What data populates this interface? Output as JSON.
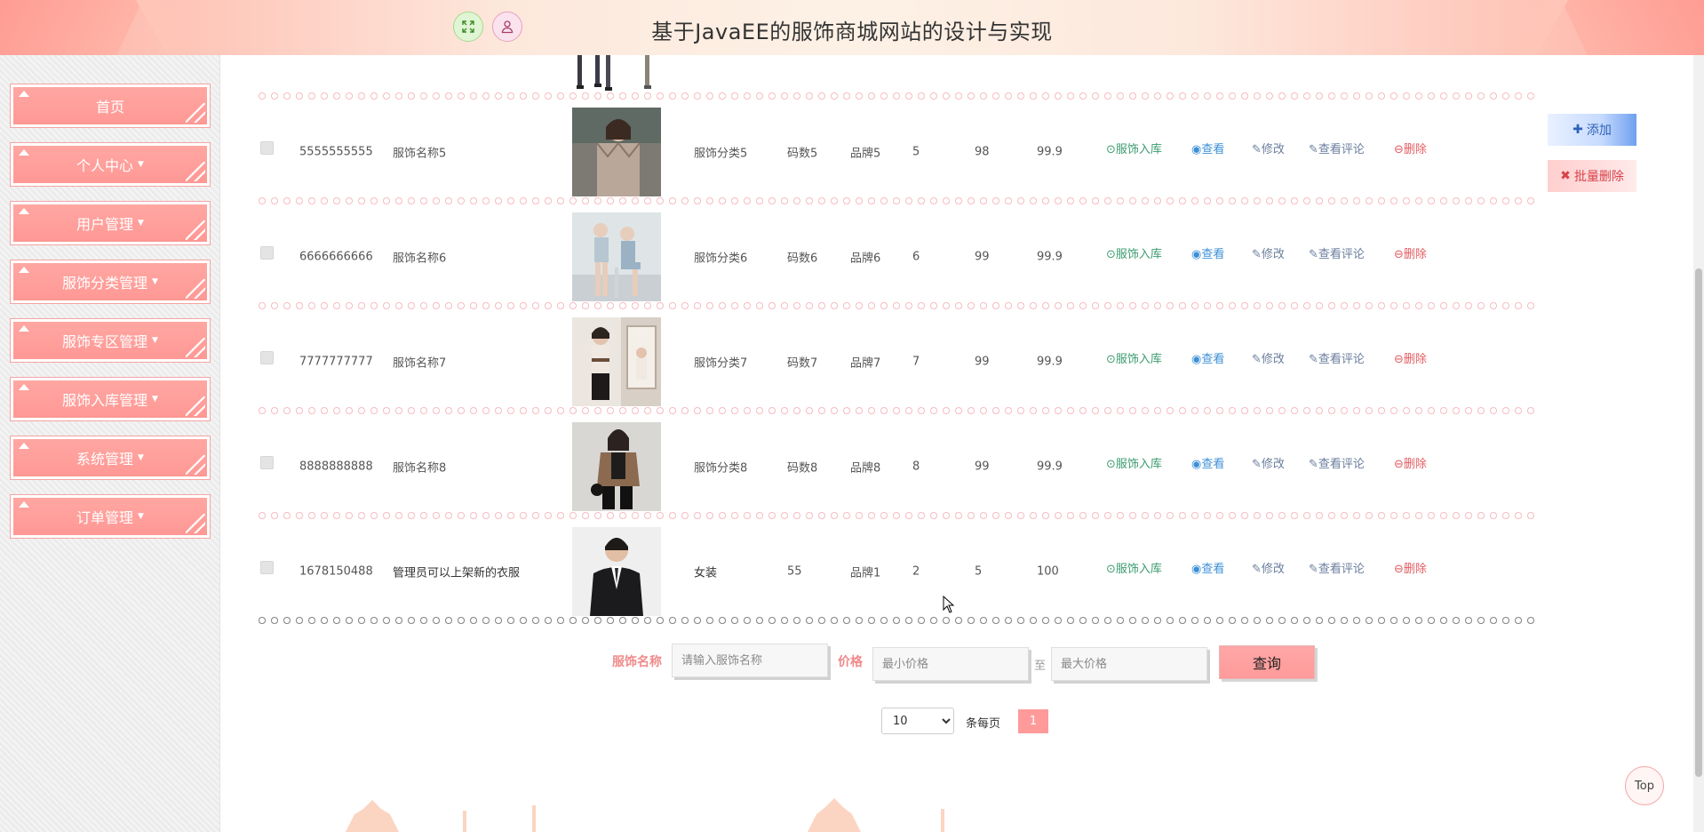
{
  "header": {
    "title": "基于JavaEE的服饰商城网站的设计与实现"
  },
  "sidebar": {
    "items": [
      {
        "label": "首页",
        "has_caret": false
      },
      {
        "label": "个人中心",
        "has_caret": true
      },
      {
        "label": "用户管理",
        "has_caret": true
      },
      {
        "label": "服饰分类管理",
        "has_caret": true
      },
      {
        "label": "服饰专区管理",
        "has_caret": true
      },
      {
        "label": "服饰入库管理",
        "has_caret": true
      },
      {
        "label": "系统管理",
        "has_caret": true
      },
      {
        "label": "订单管理",
        "has_caret": true
      }
    ]
  },
  "toolbar": {
    "add_label": "添加",
    "batch_delete_label": "批量删除"
  },
  "actions": {
    "stock_in": "服饰入库",
    "view": "查看",
    "edit": "修改",
    "view_comments": "查看评论",
    "delete": "删除"
  },
  "table": {
    "rows": [
      {
        "id": "5555555555",
        "name": "服饰名称5",
        "category": "服饰分类5",
        "size": "码数5",
        "brand": "品牌5",
        "col_a": "5",
        "col_b": "98",
        "price": "99.9"
      },
      {
        "id": "6666666666",
        "name": "服饰名称6",
        "category": "服饰分类6",
        "size": "码数6",
        "brand": "品牌6",
        "col_a": "6",
        "col_b": "99",
        "price": "99.9"
      },
      {
        "id": "7777777777",
        "name": "服饰名称7",
        "category": "服饰分类7",
        "size": "码数7",
        "brand": "品牌7",
        "col_a": "7",
        "col_b": "99",
        "price": "99.9"
      },
      {
        "id": "8888888888",
        "name": "服饰名称8",
        "category": "服饰分类8",
        "size": "码数8",
        "brand": "品牌8",
        "col_a": "8",
        "col_b": "99",
        "price": "99.9"
      },
      {
        "id": "1678150488",
        "name": "管理员可以上架新的衣服",
        "category": "女装",
        "size": "55",
        "brand": "品牌1",
        "col_a": "2",
        "col_b": "5",
        "price": "100"
      }
    ]
  },
  "search": {
    "name_label": "服饰名称",
    "name_placeholder": "请输入服饰名称",
    "price_label": "价格",
    "min_placeholder": "最小价格",
    "to_label": "至",
    "max_placeholder": "最大价格",
    "query_label": "查询"
  },
  "pagination": {
    "page_size": "10",
    "per_page_label": "条每页",
    "current_page": "1"
  },
  "top_button": "Top"
}
